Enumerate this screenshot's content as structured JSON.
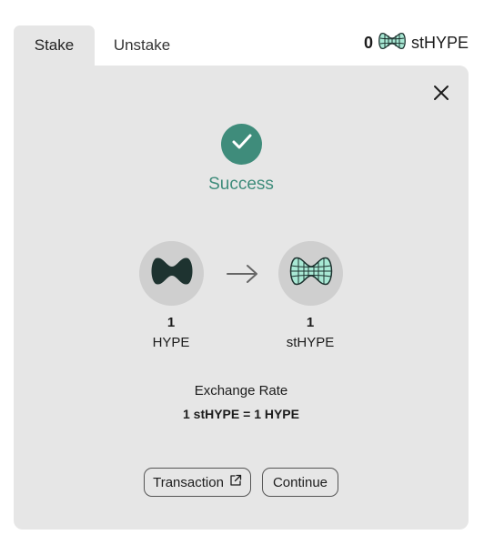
{
  "tabs": [
    {
      "label": "Stake"
    },
    {
      "label": "Unstake"
    }
  ],
  "balance": {
    "amount": "0",
    "token": "stHYPE",
    "icon": "sthype-token-icon"
  },
  "close_icon": "close-icon",
  "status": {
    "icon": "check-icon",
    "title": "Success"
  },
  "from": {
    "amount": "1",
    "symbol": "HYPE",
    "icon": "hype-token-icon"
  },
  "to": {
    "amount": "1",
    "symbol": "stHYPE",
    "icon": "sthype-token-icon"
  },
  "exchange_rate": {
    "label": "Exchange Rate",
    "value": "1 stHYPE = 1 HYPE"
  },
  "buttons": {
    "transaction": "Transaction",
    "transaction_icon": "external-link-icon",
    "continue": "Continue"
  },
  "colors": {
    "accent": "#3f8c7b",
    "panel": "#e6e6e6",
    "token_dark": "#1e3330",
    "token_mint": "#a8e8d4"
  }
}
